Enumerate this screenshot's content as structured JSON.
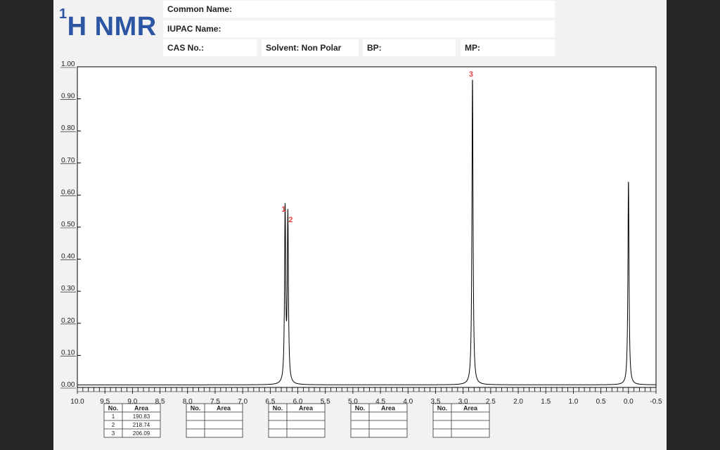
{
  "header": {
    "logo_sup": "1",
    "logo_main": "H NMR",
    "common_name_label": "Common Name:",
    "iupac_name_label": "IUPAC Name:",
    "cas_label": "CAS No.:",
    "solvent_label": "Solvent: Non Polar",
    "bp_label": "BP:",
    "mp_label": "MP:"
  },
  "colors": {
    "logo": "#2c56a3",
    "peak_label": "#e8403c",
    "spectrum": "#000000"
  },
  "chart_data": {
    "type": "line",
    "title": "",
    "xlabel": "",
    "ylabel": "",
    "xlim": [
      10.0,
      -0.5
    ],
    "x_reversed": true,
    "ylim": [
      0.0,
      1.0
    ],
    "x_ticks": [
      "10.0",
      "9.5",
      "9.0",
      "8.5",
      "8.0",
      "7.5",
      "7.0",
      "6.5",
      "6.0",
      "5.5",
      "5.0",
      "4.5",
      "4.0",
      "3.5",
      "3.0",
      "2.5",
      "2.0",
      "1.5",
      "1.0",
      "0.5",
      "0.0",
      "-0.5"
    ],
    "y_ticks": [
      "0.00",
      "0.10",
      "0.20",
      "0.30",
      "0.40",
      "0.50",
      "0.60",
      "0.70",
      "0.80",
      "0.90",
      "1.00"
    ],
    "peaks": [
      {
        "label": "1",
        "shift": 6.23,
        "height": 0.54
      },
      {
        "label": "2",
        "shift": 6.18,
        "height": 0.52
      },
      {
        "label": "3",
        "shift": 2.83,
        "height": 0.96
      },
      {
        "label": "",
        "shift": 0.0,
        "height": 0.64
      }
    ],
    "peak_tables": [
      {
        "headers": [
          "No.",
          "Area"
        ],
        "rows": [
          [
            "1",
            "190.83"
          ],
          [
            "2",
            "218.74"
          ],
          [
            "3",
            "206.09"
          ]
        ]
      },
      {
        "headers": [
          "No.",
          "Area"
        ],
        "rows": [
          [
            "",
            ""
          ],
          [
            "",
            ""
          ],
          [
            "",
            ""
          ]
        ]
      },
      {
        "headers": [
          "No.",
          "Area"
        ],
        "rows": [
          [
            "",
            ""
          ],
          [
            "",
            ""
          ],
          [
            "",
            ""
          ]
        ]
      },
      {
        "headers": [
          "No.",
          "Area"
        ],
        "rows": [
          [
            "",
            ""
          ],
          [
            "",
            ""
          ],
          [
            "",
            ""
          ]
        ]
      },
      {
        "headers": [
          "No.",
          "Area"
        ],
        "rows": [
          [
            "",
            ""
          ],
          [
            "",
            ""
          ],
          [
            "",
            ""
          ]
        ]
      }
    ]
  }
}
